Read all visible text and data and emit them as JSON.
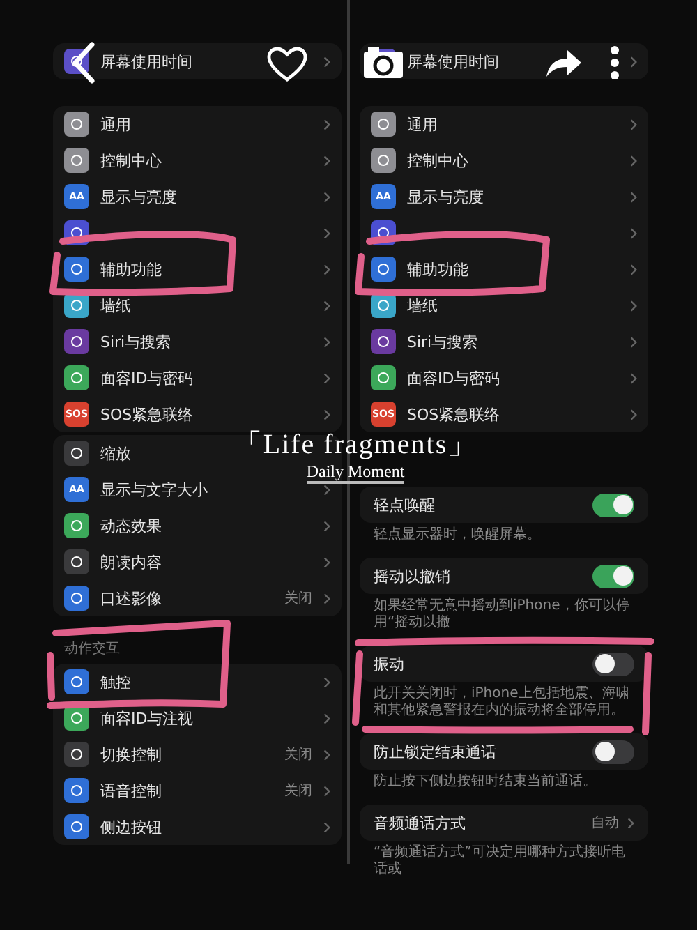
{
  "left_screen": {
    "sections": [
      {
        "rows": [
          {
            "label": "屏幕使用时间",
            "color": "#5b4fc7"
          }
        ]
      },
      {
        "rows": [
          {
            "label": "通用",
            "color": "#8e8e93"
          },
          {
            "label": "控制中心",
            "color": "#8e8e93"
          },
          {
            "label": "显示与亮度",
            "color": "#2f6fd6",
            "icon_text": "AA"
          },
          {
            "color": "#4b4fd0"
          },
          {
            "label": "辅助功能",
            "color": "#2f6fd6"
          },
          {
            "label": "墙纸",
            "color": "#3aa6c8"
          },
          {
            "label": "Siri与搜索",
            "color": "#6a3aa0"
          },
          {
            "label": "面容ID与密码",
            "color": "#3ca85a"
          },
          {
            "label": "SOS紧急联络",
            "color": "#d8412f",
            "icon_text": "SOS"
          }
        ]
      },
      {
        "rows": [
          {
            "label": "缩放",
            "color": "#3a3a3c",
            "chevron": false
          },
          {
            "label": "显示与文字大小",
            "color": "#2f6fd6",
            "icon_text": "AA"
          },
          {
            "label": "动态效果",
            "color": "#3ca85a"
          },
          {
            "label": "朗读内容",
            "color": "#3a3a3c"
          },
          {
            "label": "口述影像",
            "color": "#2f6fd6",
            "value": "关闭"
          }
        ]
      },
      {
        "header": "动作交互",
        "rows": [
          {
            "label": "触控",
            "color": "#2f6fd6"
          },
          {
            "label": "面容ID与注视",
            "color": "#3ca85a"
          },
          {
            "label": "切换控制",
            "color": "#3a3a3c",
            "value": "关闭"
          },
          {
            "label": "语音控制",
            "color": "#2f6fd6",
            "value": "关闭"
          },
          {
            "label": "侧边按钮",
            "color": "#2f6fd6"
          }
        ]
      }
    ]
  },
  "right_screen": {
    "sections": [
      {
        "rows": [
          {
            "label": "屏幕使用时间",
            "color": "#5b4fc7"
          }
        ]
      },
      {
        "rows": [
          {
            "label": "通用",
            "color": "#8e8e93"
          },
          {
            "label": "控制中心",
            "color": "#8e8e93"
          },
          {
            "label": "显示与亮度",
            "color": "#2f6fd6",
            "icon_text": "AA"
          },
          {
            "color": "#4b4fd0"
          },
          {
            "label": "辅助功能",
            "color": "#2f6fd6"
          },
          {
            "label": "墙纸",
            "color": "#3aa6c8"
          },
          {
            "label": "Siri与搜索",
            "color": "#6a3aa0"
          },
          {
            "label": "面容ID与密码",
            "color": "#3ca85a"
          },
          {
            "label": "SOS紧急联络",
            "color": "#d8412f",
            "icon_text": "SOS"
          }
        ]
      }
    ],
    "settings": [
      {
        "kind": "toggle",
        "label": "轻点唤醒",
        "on": true,
        "description": "轻点显示器时，唤醒屏幕。"
      },
      {
        "kind": "toggle",
        "label": "摇动以撤销",
        "on": true,
        "description": "如果经常无意中摇动到iPhone，你可以停用“摇动以撤"
      },
      {
        "kind": "toggle",
        "label": "振动",
        "on": false,
        "description": "此开关关闭时，iPhone上包括地震、海啸和其他紧急警报在内的振动将全部停用。"
      },
      {
        "kind": "toggle",
        "label": "防止锁定结束通话",
        "on": false,
        "description": "防止按下侧边按钮时结束当前通话。"
      },
      {
        "kind": "link",
        "label": "音频通话方式",
        "value": "自动",
        "description": "“音频通话方式”可决定用哪种方式接听电话或"
      }
    ]
  },
  "overlay": {
    "title": "「Life fragments」",
    "subtitle": "Daily Moment"
  }
}
